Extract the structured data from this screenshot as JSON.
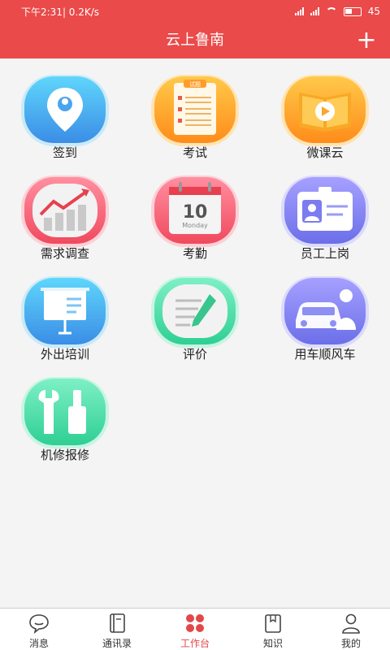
{
  "status_bar": {
    "time_speed": "下午2:31| 0.2K/s",
    "battery": "45"
  },
  "header": {
    "title": "云上鲁南",
    "add_label": "+"
  },
  "apps": [
    {
      "label": "签到",
      "icon": "location-pin-icon"
    },
    {
      "label": "考试",
      "icon": "exam-sheet-icon",
      "badge": "试题"
    },
    {
      "label": "微课云",
      "icon": "video-book-icon"
    },
    {
      "label": "需求调查",
      "icon": "chart-trend-icon"
    },
    {
      "label": "考勤",
      "icon": "calendar-icon",
      "day": "10",
      "weekday": "Monday"
    },
    {
      "label": "员工上岗",
      "icon": "id-card-icon"
    },
    {
      "label": "外出培训",
      "icon": "presentation-board-icon"
    },
    {
      "label": "评价",
      "icon": "document-pen-icon"
    },
    {
      "label": "用车顺风车",
      "icon": "car-person-icon"
    },
    {
      "label": "机修报修",
      "icon": "wrench-tools-icon"
    }
  ],
  "tabs": [
    {
      "label": "消息",
      "icon": "chat-bubble-icon"
    },
    {
      "label": "通讯录",
      "icon": "contact-book-icon"
    },
    {
      "label": "工作台",
      "icon": "workbench-clover-icon"
    },
    {
      "label": "知识",
      "icon": "knowledge-book-icon"
    },
    {
      "label": "我的",
      "icon": "person-icon"
    }
  ],
  "colors": {
    "brand": "#ea4a4a",
    "active_tab": "#e24848"
  }
}
